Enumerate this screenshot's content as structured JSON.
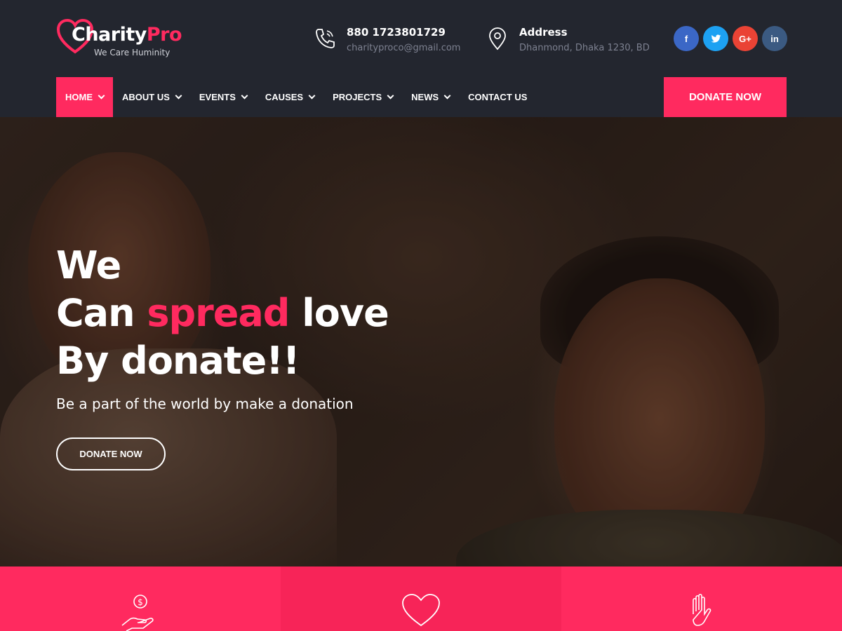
{
  "brand": {
    "name_a": "Charity",
    "name_b": "Pro",
    "tagline": "We Care Huminity"
  },
  "contact": {
    "phone": "880 1723801729",
    "email": "charityproco@gmail.com",
    "address_label": "Address",
    "address": "Dhanmond, Dhaka 1230, BD"
  },
  "socials": [
    {
      "name": "facebook",
      "glyph": "f",
      "color": "#3b67c6"
    },
    {
      "name": "twitter",
      "glyph": "t",
      "color": "#1da1f2"
    },
    {
      "name": "google-plus",
      "glyph": "G+",
      "color": "#ea4335"
    },
    {
      "name": "linkedin",
      "glyph": "in",
      "color": "#3b5a82"
    }
  ],
  "nav": {
    "items": [
      {
        "label": "HOME",
        "active": true
      },
      {
        "label": "ABOUT US"
      },
      {
        "label": "EVENTS"
      },
      {
        "label": "CAUSES"
      },
      {
        "label": "PROJECTS"
      },
      {
        "label": "NEWS"
      },
      {
        "label": "CONTACT US"
      }
    ],
    "donate": "DONATE NOW"
  },
  "hero": {
    "line1": "We",
    "line2_a": "Can ",
    "line2_b": "spread",
    "line2_c": " love",
    "line3": "By donate!!",
    "subtitle": "Be a part of the world by make a donation",
    "button": "DONATE NOW"
  },
  "features": [
    {
      "icon": "hand-coin-icon"
    },
    {
      "icon": "heart-icon"
    },
    {
      "icon": "raised-hand-icon"
    }
  ],
  "colors": {
    "accent": "#ff2a5f",
    "header_bg": "#23262f"
  }
}
